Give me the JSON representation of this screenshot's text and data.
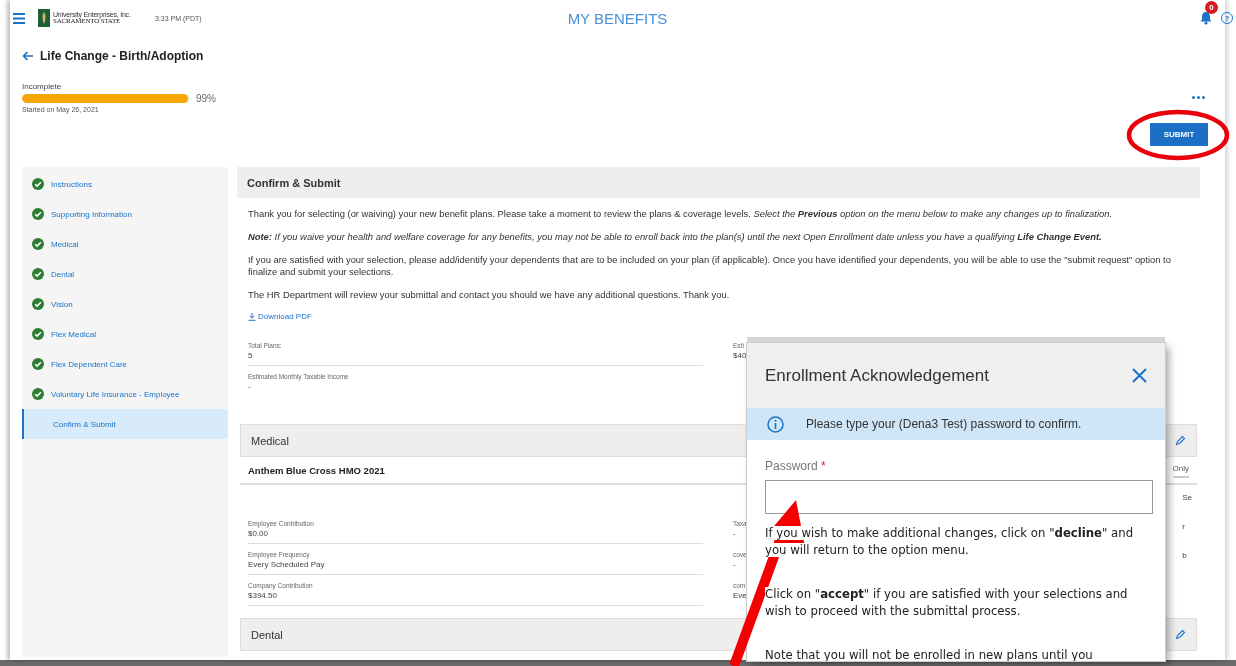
{
  "header": {
    "logo_lines": [
      "University Enterprises, Inc.",
      "SACRAMENTO STATE"
    ],
    "time": "3:33 PM (PDT)",
    "title": "MY BENEFITS",
    "notification_count": "0",
    "help": "?"
  },
  "page": {
    "title": "Life Change - Birth/Adoption",
    "status": "Incomplete",
    "progress": {
      "level": 0.99,
      "reading": "99%"
    },
    "started": "Started on May 26, 2021",
    "submit": "SUBMIT"
  },
  "sidebar": {
    "items": [
      {
        "label": "Instructions",
        "complete": true,
        "selected": false
      },
      {
        "label": "Supporting Information",
        "complete": true,
        "selected": false
      },
      {
        "label": "Medical",
        "complete": true,
        "selected": false
      },
      {
        "label": "Dental",
        "complete": true,
        "selected": false
      },
      {
        "label": "Vision",
        "complete": true,
        "selected": false
      },
      {
        "label": "Flex Medical",
        "complete": true,
        "selected": false
      },
      {
        "label": "Flex Dependent Care",
        "complete": true,
        "selected": false
      },
      {
        "label": "Voluntary Life Insurance - Employee",
        "complete": true,
        "selected": false
      },
      {
        "label": "Confirm & Submit",
        "complete": false,
        "selected": true
      }
    ]
  },
  "confirm": {
    "title": "Confirm & Submit",
    "paragraphs": [
      "Thank you for selecting (or waiving) your new benefit plans. Please take a moment to review the plans & coverage levels. *Select the* **Previous** *option on the menu below to make any changes up to finalization.*",
      "**Note:** *If you waive your health and welfare coverage for any benefits, you may not be able to enroll back into the plan(s) until the next Open Enrollment date unless you have a qualifying* **Life Change Event.**",
      "If you are satisfied with your selection, please add/identify your dependents that are to be included on your plan (if applicable). Once you have identified your dependents, you will be able to use the \"submit request\" option to finalize and submit your selections.",
      "The HR Department will review your submittal and contact you should we have any additional questions. Thank you."
    ],
    "download": "Download PDF",
    "summary": [
      {
        "label": "Total Plans:",
        "value": "5",
        "side_label": "Esti",
        "side_value": "$40"
      },
      {
        "label": "Estimated Monthly Taxable Income",
        "value": "-"
      }
    ]
  },
  "medical": {
    "title": "Medical",
    "plan": "Anthem Blue Cross HMO 2021",
    "tab_fragment": "Only",
    "side_fragments": [
      "Se",
      "r",
      "b"
    ],
    "fields": [
      {
        "label": "Employee Contribution",
        "value": "$0.00",
        "side_label": "Taxa",
        "side_value": "-"
      },
      {
        "label": "Employee Frequency",
        "value": "Every Scheduled Pay",
        "side_label": "cove",
        "side_value": "-"
      },
      {
        "label": "Company Contribution",
        "value": "$394.50",
        "side_label": "com",
        "side_value": "Eve"
      }
    ]
  },
  "dental": {
    "title": "Dental"
  },
  "dialog": {
    "title": "Enrollment Acknowledgement",
    "info": "Please type your (Dena3 Test) password to confirm.",
    "field_label": "Password",
    "required_mark": "*",
    "paragraphs": [
      "If you wish to make additional changes, click on \"**decline**\" and you will return to the option menu.",
      "Click on \"**accept**\" if you are satisfied with your selections and wish to proceed with the submittal process.",
      "Note that you will not be enrolled in new plans until you"
    ]
  },
  "annotations": [
    {
      "kind": "ellipse"
    },
    {
      "kind": "arrow"
    }
  ]
}
